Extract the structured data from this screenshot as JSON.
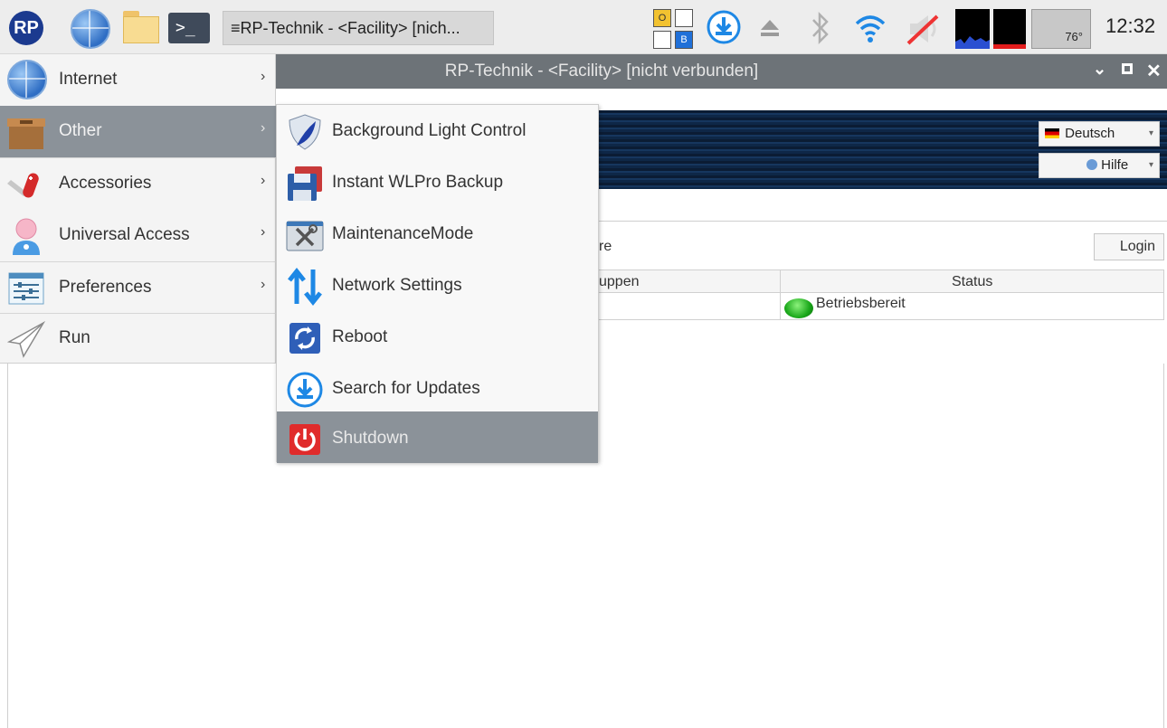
{
  "taskbar": {
    "logo_text": "RP",
    "active_window_button": "≡RP-Technik - <Facility> [nich...",
    "ob_indicator": {
      "o": "O",
      "b": "B"
    },
    "temperature": "76°",
    "clock": "12:32",
    "colors": {
      "accent_blue": "#1e88e5",
      "cpu_graph": "#000000"
    }
  },
  "window": {
    "title": "RP-Technik - <Facility> [nicht verbunden]",
    "controls": [
      "chevron-down-icon",
      "maximize-icon",
      "close-icon"
    ],
    "language_select": "Deutsch",
    "help_select": "Hilfe",
    "partial_label_left": "re",
    "login_button": "Login",
    "table": {
      "columns": [
        "uppen",
        "Status"
      ],
      "rows": [
        {
          "col1": "",
          "status": "Betriebsbereit",
          "status_color": "#1aa81a"
        }
      ]
    }
  },
  "menu": {
    "items": [
      {
        "label": "Internet",
        "icon": "globe-icon",
        "has_submenu": true
      },
      {
        "label": "Other",
        "icon": "box-icon",
        "has_submenu": true,
        "active": true
      },
      {
        "label": "Accessories",
        "icon": "pocketknife-icon",
        "has_submenu": true
      },
      {
        "label": "Universal Access",
        "icon": "person-icon",
        "has_submenu": true
      },
      {
        "label": "Preferences",
        "icon": "sliders-icon",
        "has_submenu": true
      },
      {
        "label": "Run",
        "icon": "paper-plane-icon",
        "has_submenu": false
      }
    ],
    "arrow": "›"
  },
  "submenu": {
    "items": [
      {
        "label": "Background Light Control",
        "icon": "shield-icon"
      },
      {
        "label": "Instant WLPro Backup",
        "icon": "floppy-icon"
      },
      {
        "label": "MaintenanceMode",
        "icon": "tools-icon"
      },
      {
        "label": "Network Settings",
        "icon": "updown-arrows-icon"
      },
      {
        "label": "Reboot",
        "icon": "reboot-icon"
      },
      {
        "label": "Search for Updates",
        "icon": "download-icon"
      },
      {
        "label": "Shutdown",
        "icon": "power-icon",
        "active": true
      }
    ],
    "highlight_color": "#8b9299"
  }
}
